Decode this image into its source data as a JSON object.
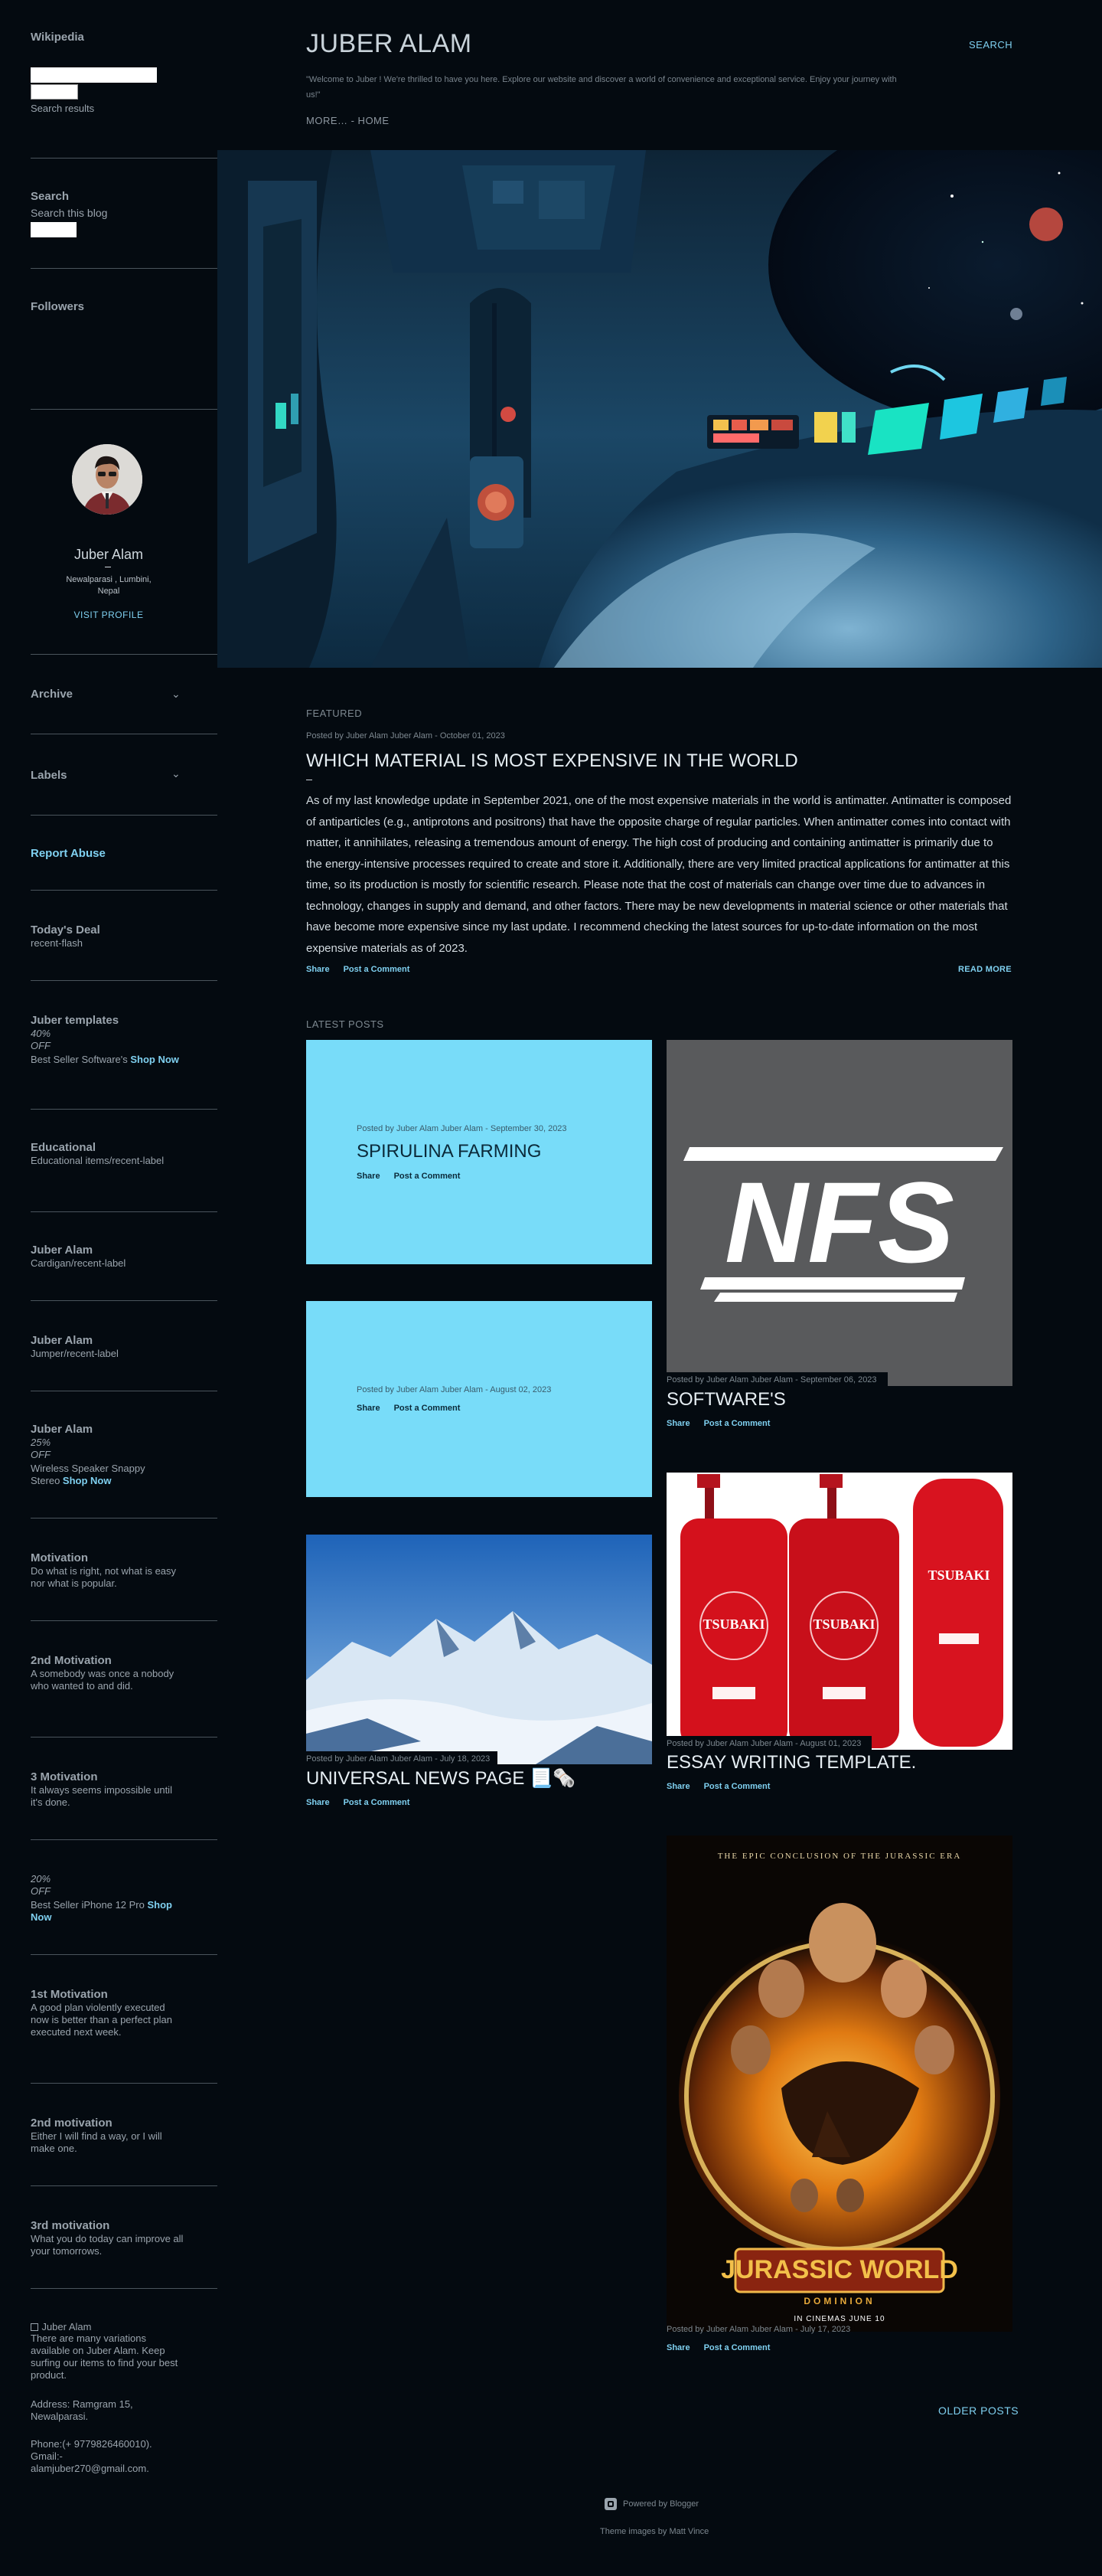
{
  "sidebar": {
    "wikipedia": {
      "title": "Wikipedia",
      "results_label": "Search results"
    },
    "search": {
      "title": "Search",
      "subtitle": "Search this blog"
    },
    "followers": {
      "title": "Followers"
    },
    "profile": {
      "name": "Juber Alam",
      "location": "Newalparasi , Lumbini, Nepal",
      "visit": "VISIT PROFILE"
    },
    "archive": "Archive",
    "labels": "Labels",
    "report_abuse": "Report Abuse",
    "todays_deal": {
      "title": "Today's Deal",
      "text": "recent-flash"
    },
    "juber_templates": {
      "title": "Juber templates",
      "percent": "40%",
      "off": "OFF",
      "text": "Best Seller Software's ",
      "shop": "Shop Now"
    },
    "educational": {
      "title": "Educational",
      "text": "Educational items/recent-label"
    },
    "juber_cardigan": {
      "title": "Juber Alam",
      "text": "Cardigan/recent-label"
    },
    "juber_jumper": {
      "title": "Juber Alam",
      "text": "Jumper/recent-label"
    },
    "juber_speaker": {
      "title": "Juber Alam",
      "percent": "25%",
      "off": "OFF",
      "text": "Wireless Speaker Snappy Stereo ",
      "shop": "Shop Now"
    },
    "motivation": {
      "title": "Motivation",
      "text": "Do what is right, not what is easy nor what is popular."
    },
    "second_motivation": {
      "title": "2nd Motivation",
      "text": "A somebody was once a nobody who wanted to and did."
    },
    "third_motivation": {
      "title": "3 Motivation",
      "text": "It always seems impossible until it's done."
    },
    "iphone": {
      "percent": "20%",
      "off": "OFF",
      "text": "Best Seller iPhone 12 Pro ",
      "shop": "Shop Now"
    },
    "first_motivation": {
      "title": "1st Motivation",
      "text": "A good plan violently executed now is better than a perfect plan executed next week."
    },
    "second_motivation_b": {
      "title": "2nd motivation",
      "text": "Either I will find a way, or I will make one."
    },
    "third_motivation_b": {
      "title": "3rd motivation",
      "text": "What you do today can improve all your tomorrows."
    },
    "about": {
      "img_alt": "Juber Alam",
      "text": "There are many variations available on Juber Alam. Keep surfing our items to find your best product.",
      "address": "Address: Ramgram 15, Newalparasi.",
      "phone": "Phone:(+ 9779826460010).",
      "gmail": "Gmail:- alamjuber270@gmail.com."
    }
  },
  "header": {
    "title": "JUBER ALAM",
    "description": "\"Welcome to Juber ! We're thrilled to have you here. Explore our website and discover a world of convenience and exceptional service. Enjoy your journey with us!\"",
    "more_home": "MORE… - HOME",
    "search": "SEARCH"
  },
  "featured": {
    "label": "FEATURED",
    "meta": "Posted by Juber Alam Juber Alam - October 01, 2023",
    "title": "WHICH MATERIAL IS MOST EXPENSIVE IN THE WORLD",
    "body": " As of my last knowledge update in September 2021, one of the most expensive materials in the world is antimatter. Antimatter is composed of antiparticles (e.g., antiprotons and positrons) that have the opposite charge of regular particles. When antimatter comes into contact with matter, it annihilates, releasing a tremendous amount of energy. The high cost of producing and containing antimatter is primarily due to the energy-intensive processes required to create and store it. Additionally, there are very limited practical applications for antimatter at this time, so its production is mostly for scientific research. Please note that the cost of materials can change over time due to advances in technology, changes in supply and demand, and other factors. There may be new developments in material science or other materials that have become more expensive since my last update. I recommend checking the latest sources for up-to-date information on the most expensive materials as of 2023.",
    "share": "Share",
    "post_comment": "Post a Comment",
    "read_more": "READ MORE"
  },
  "latest": {
    "label": "LATEST POSTS",
    "share": "Share",
    "post_comment": "Post a Comment",
    "posts": [
      {
        "meta": "Posted by Juber Alam Juber Alam - September 30, 2023",
        "title": "SPIRULINA FARMING"
      },
      {
        "meta": "Posted by Juber Alam Juber Alam - September 06, 2023",
        "title": "SOFTWARE'S",
        "logo": "NFS"
      },
      {
        "meta": "Posted by Juber Alam Juber Alam - August 02, 2023",
        "title": ""
      },
      {
        "meta": "Posted by Juber Alam Juber Alam - August 01, 2023",
        "title": "ESSAY WRITING TEMPLATE.",
        "product_brand": "TSUBAKI"
      },
      {
        "meta": "Posted by Juber Alam Juber Alam - July 18, 2023",
        "title": "UNIVERSAL NEWS PAGE 📃🗞️"
      },
      {
        "meta": "Posted by Juber Alam Juber Alam - July 17, 2023",
        "title": "",
        "poster_top": "THE EPIC CONCLUSION OF THE JURASSIC ERA",
        "poster_title": "JURASSIC WORLD",
        "poster_sub": "DOMINION",
        "poster_date": "IN CINEMAS JUNE 10"
      }
    ],
    "older": "OLDER POSTS"
  },
  "footer": {
    "powered": "Powered by Blogger",
    "theme": "Theme images by Matt Vince"
  },
  "colors": {
    "background": "#040a10",
    "accent": "#7fd0f0",
    "card_light": "#78dcf9"
  }
}
